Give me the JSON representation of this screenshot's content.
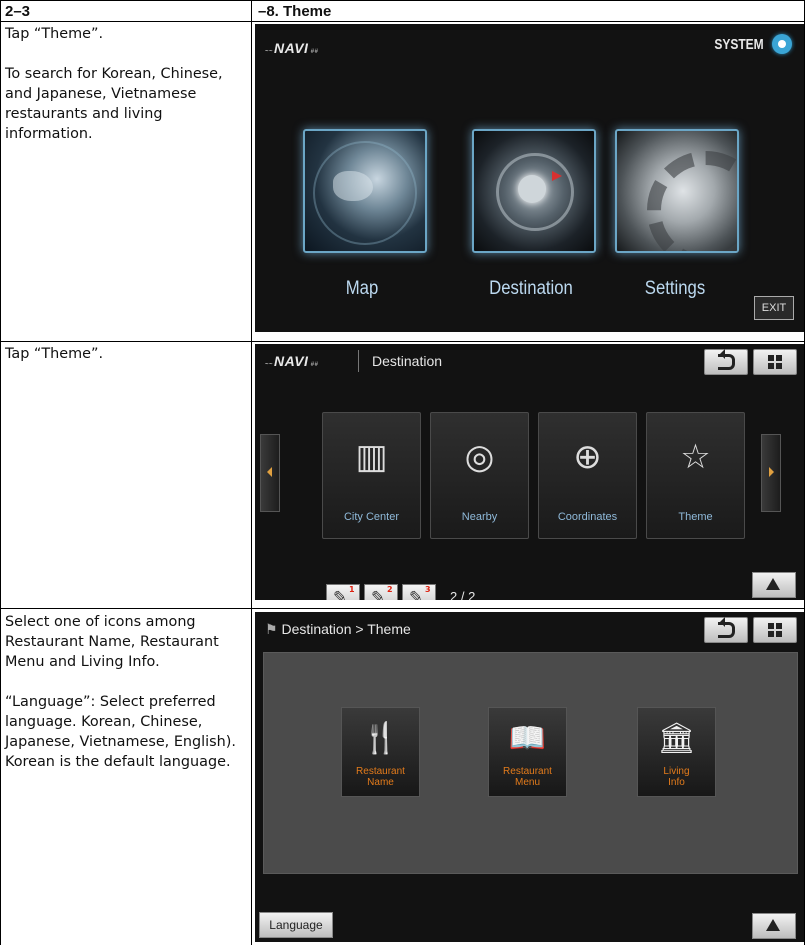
{
  "header": {
    "section": "2–3",
    "title": "–8. Theme"
  },
  "rows": [
    {
      "description": [
        "Tap “Theme”.",
        "To search for Korean, Chinese, and Japanese, Vietnamese restaurants and living information."
      ],
      "screen": {
        "logo": "NAVI",
        "system_label": "SYSTEM",
        "menu": [
          "Map",
          "Destination",
          "Settings"
        ],
        "exit_label": "EXIT"
      }
    },
    {
      "description": [
        "Tap “Theme”."
      ],
      "screen": {
        "logo": "NAVI",
        "title": "Destination",
        "cards": [
          "City Center",
          "Nearby",
          "Coordinates",
          "Theme"
        ],
        "favorites": [
          "1",
          "2",
          "3"
        ],
        "page_indicator": "2 / 2"
      }
    },
    {
      "description": [
        "Select one of icons among Restaurant Name, Restaurant Menu and Living Info.",
        "“Language”: Select preferred language. Korean, Chinese, Japanese, Vietnamese, English). Korean is the default language."
      ],
      "screen": {
        "breadcrumb": "Destination > Theme",
        "cards": [
          {
            "line1": "Restaurant",
            "line2": "Name"
          },
          {
            "line1": "Restaurant",
            "line2": "Menu"
          },
          {
            "line1": "Living",
            "line2": "Info"
          }
        ],
        "language_label": "Language"
      }
    }
  ],
  "icons": {
    "system": "system-settings-icon",
    "back": "back-arrow-icon",
    "menu": "grid-menu-icon",
    "up": "up-arrow-icon"
  },
  "colors": {
    "screen_bg": "#121212",
    "menu_label": "#bcd9f0",
    "card_label": "#8fb9d9",
    "theme_label": "#e37b1b",
    "system_accent": "#3aa5d6"
  }
}
